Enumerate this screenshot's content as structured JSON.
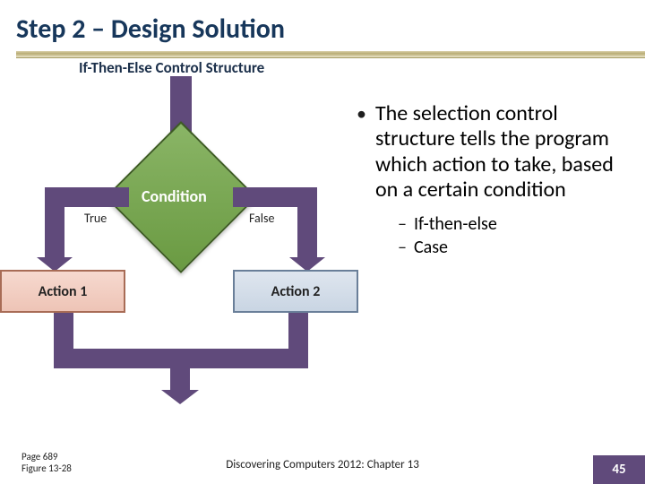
{
  "title": "Step 2 – Design Solution",
  "diagram": {
    "heading": "If-Then-Else Control Structure",
    "condition": "Condition",
    "true_label": "True",
    "false_label": "False",
    "action1": "Action 1",
    "action2": "Action 2"
  },
  "body": {
    "main_bullet": "The selection control structure tells the program which action to take, based on a certain condition",
    "sub1": "If-then-else",
    "sub2": "Case"
  },
  "footer": {
    "page_ref_line1": "Page 689",
    "page_ref_line2": "Figure 13-28",
    "center": "Discovering Computers 2012: Chapter 13",
    "slide_number": "45"
  }
}
